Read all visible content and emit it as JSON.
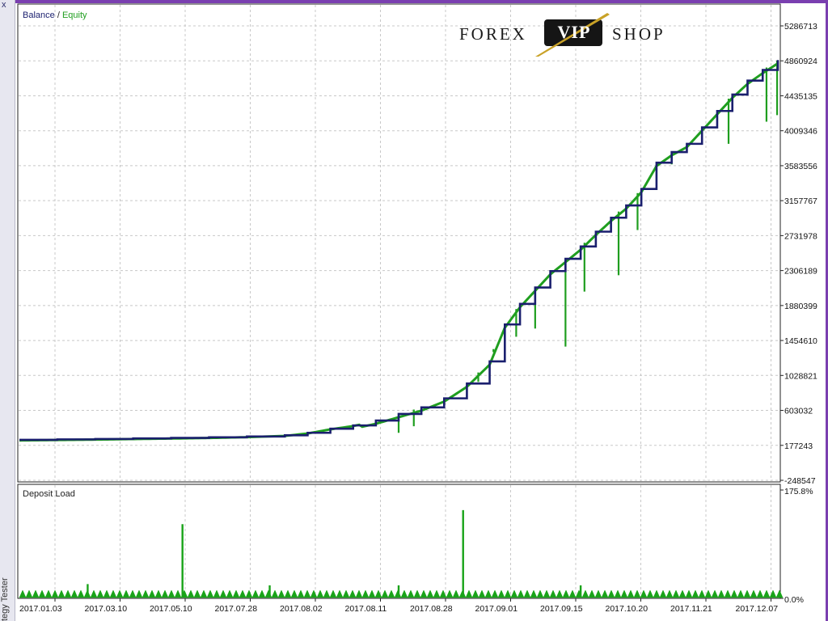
{
  "window": {
    "side_title": "tegy Tester",
    "close_glyph": "x"
  },
  "logo": {
    "left_word": "FOREX",
    "badge_word": "VIP",
    "right_word": "SHOP",
    "accent_color": "#c9a227"
  },
  "colors": {
    "balance": "#1a1f6e",
    "equity": "#1f9e1f",
    "deposit_load": "#19a319",
    "grid": "#c8c8c8"
  },
  "chart_data": [
    {
      "type": "line",
      "title": "Balance / Equity",
      "title_parts": {
        "balance": "Balance",
        "separator": " / ",
        "equity": "Equity"
      },
      "ylim": [
        -248547,
        5286713
      ],
      "y_ticks": [
        5286713,
        4860924,
        4435135,
        4009346,
        3583556,
        3157767,
        2731978,
        2306189,
        1880399,
        1454610,
        1028821,
        603032,
        177243,
        -248547
      ],
      "y_tick_labels": [
        "5286713",
        "4860924",
        "4435135",
        "4009346",
        "3583556",
        "3157767",
        "2731978",
        "2306189",
        "1880399",
        "1454610",
        "1028821",
        "603032",
        "177243",
        "-248547"
      ],
      "x_labels": [
        "2017.01.03",
        "2017.03.10",
        "2017.05.10",
        "2017.07.28",
        "2017.08.02",
        "2017.08.11",
        "2017.08.28",
        "2017.09.01",
        "2017.09.15",
        "2017.10.20",
        "2017.11.21",
        "2017.12.07"
      ],
      "grid": true,
      "series": [
        {
          "name": "Balance",
          "x": [
            0,
            0.05,
            0.1,
            0.15,
            0.2,
            0.25,
            0.3,
            0.35,
            0.38,
            0.41,
            0.44,
            0.47,
            0.5,
            0.53,
            0.56,
            0.59,
            0.62,
            0.64,
            0.66,
            0.68,
            0.7,
            0.72,
            0.74,
            0.76,
            0.78,
            0.8,
            0.82,
            0.84,
            0.86,
            0.88,
            0.9,
            0.92,
            0.94,
            0.96,
            0.98,
            1.0
          ],
          "values": [
            245000,
            250000,
            255000,
            262000,
            268000,
            275000,
            285000,
            300000,
            330000,
            380000,
            420000,
            480000,
            560000,
            640000,
            750000,
            930000,
            1200000,
            1650000,
            1900000,
            2100000,
            2300000,
            2450000,
            2600000,
            2780000,
            2950000,
            3100000,
            3300000,
            3620000,
            3750000,
            3850000,
            4050000,
            4250000,
            4450000,
            4620000,
            4750000,
            4870000
          ]
        },
        {
          "name": "Equity",
          "drawdowns": [
            {
              "x": 0.5,
              "value": 330000
            },
            {
              "x": 0.52,
              "value": 410000
            },
            {
              "x": 0.59,
              "value": 750000
            },
            {
              "x": 0.605,
              "value": 950000
            },
            {
              "x": 0.625,
              "value": 1350000
            },
            {
              "x": 0.655,
              "value": 1500000
            },
            {
              "x": 0.68,
              "value": 1600000
            },
            {
              "x": 0.72,
              "value": 1380000
            },
            {
              "x": 0.745,
              "value": 2050000
            },
            {
              "x": 0.79,
              "value": 2250000
            },
            {
              "x": 0.815,
              "value": 2800000
            },
            {
              "x": 0.86,
              "value": 3600000
            },
            {
              "x": 0.935,
              "value": 3850000
            },
            {
              "x": 0.985,
              "value": 4120000
            },
            {
              "x": 0.999,
              "value": 4200000
            }
          ]
        }
      ]
    },
    {
      "type": "bar",
      "title": "Deposit Load",
      "ylim": [
        0,
        175.8
      ],
      "y_tick_labels": [
        "175.8%",
        "0.0%"
      ],
      "spikes": [
        {
          "x": 0.215,
          "value": 120
        },
        {
          "x": 0.585,
          "value": 143
        },
        {
          "x": 0.09,
          "value": 22
        },
        {
          "x": 0.33,
          "value": 20
        },
        {
          "x": 0.5,
          "value": 20
        },
        {
          "x": 0.74,
          "value": 20
        }
      ],
      "baseline_value": 12
    }
  ]
}
